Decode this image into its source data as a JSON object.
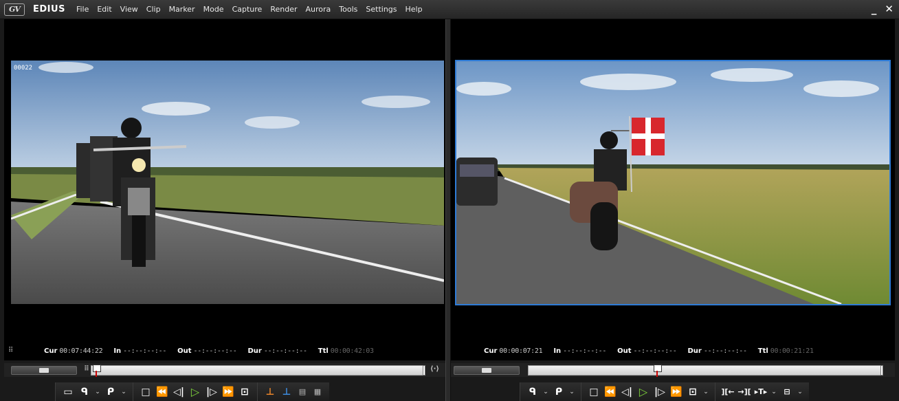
{
  "app": {
    "logo_text": "GV",
    "name": "EDIUS"
  },
  "menu": [
    "File",
    "Edit",
    "View",
    "Clip",
    "Marker",
    "Mode",
    "Capture",
    "Render",
    "Aurora",
    "Tools",
    "Settings",
    "Help"
  ],
  "window_controls": {
    "minimize": "_",
    "close": "✕"
  },
  "player": {
    "clip_label": "00022",
    "cur_label": "Cur",
    "cur": "00:07:44:22",
    "in_label": "In",
    "in": "--:--:--:--",
    "out_label": "Out",
    "out": "--:--:--:--",
    "dur_label": "Dur",
    "dur": "--:--:--:--",
    "ttl_label": "Ttl",
    "ttl": "00:00:42:03"
  },
  "recorder": {
    "cur_label": "Cur",
    "cur": "00:00:07:21",
    "in_label": "In",
    "in": "--:--:--:--",
    "out_label": "Out",
    "out": "--:--:--:--",
    "dur_label": "Dur",
    "dur": "--:--:--:--",
    "ttl_label": "Ttl",
    "ttl": "00:00:21:21"
  },
  "icons": {
    "player_controls": [
      "cue-icon",
      "set-in-icon",
      "set-out-icon",
      "stop-icon",
      "rewind-icon",
      "step-back-icon",
      "play-icon",
      "step-forward-icon",
      "fast-forward-icon",
      "loop-play-icon",
      "insert-to-timeline-icon",
      "overwrite-to-timeline-icon",
      "add-to-bin-icon",
      "sync-icon"
    ],
    "recorder_controls": [
      "set-in-icon",
      "set-out-icon",
      "stop-icon",
      "rewind-icon",
      "step-back-icon",
      "play-icon",
      "step-forward-icon",
      "fast-forward-icon",
      "loop-play-icon",
      "prev-edit-icon",
      "next-edit-icon",
      "split-icon",
      "export-icon"
    ]
  },
  "colors": {
    "accent_blue": "#2e7bd6",
    "play_green": "#7dd13a",
    "timecode_gray": "#cccccc"
  }
}
